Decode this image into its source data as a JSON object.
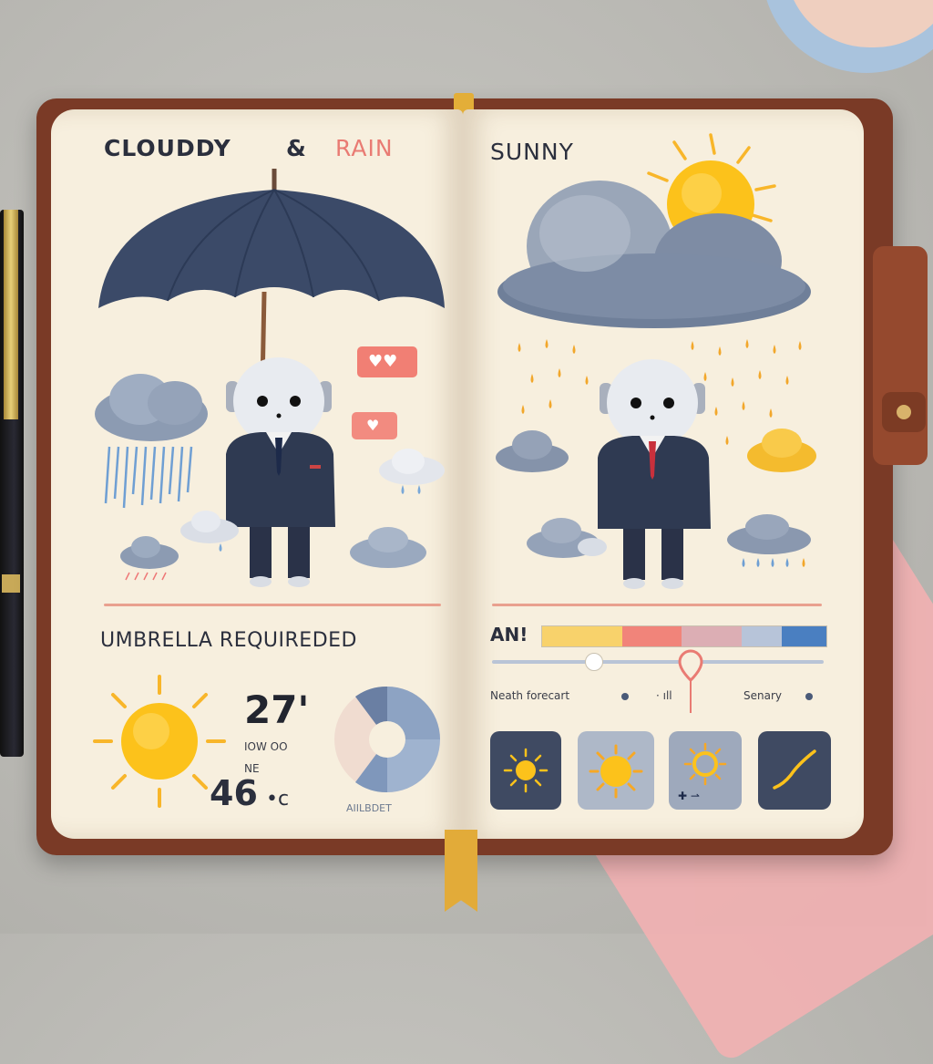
{
  "left_page": {
    "title_part1": "CLOUDDY",
    "title_amp": "&",
    "title_part2": "RAIN",
    "banner": "UMBRELLA REQUIREDED",
    "temp_high": "27'",
    "temp_low_label": "IOW  OO",
    "temp_sub_label": "NE",
    "temp_low": "46",
    "temp_unit": "•c",
    "dial_label": "AIILBDET"
  },
  "right_page": {
    "title": "SUNNY",
    "timeline_label": "AN!",
    "forecast_label": "Neath forecart",
    "forecast_mid": "· ıll",
    "sunny_label": "Senary",
    "tiles": [
      {
        "name": "sun-small-tile",
        "icon": "sun-icon"
      },
      {
        "name": "sun-large-tile",
        "icon": "sun-icon"
      },
      {
        "name": "sun-ring-tile",
        "icon": "sun-ring-icon",
        "caption": "✚ ⇀"
      },
      {
        "name": "trend-tile",
        "icon": "trend-line-icon"
      }
    ]
  },
  "colors": {
    "sun": "#fcc21b",
    "cloud": "#8c9bb2",
    "suit": "#2f3a52",
    "accent": "#e97b73",
    "timeline": [
      "#f8d26b",
      "#f1847a",
      "#dcaeb4",
      "#b7c4d9",
      "#4a7fc1"
    ]
  }
}
